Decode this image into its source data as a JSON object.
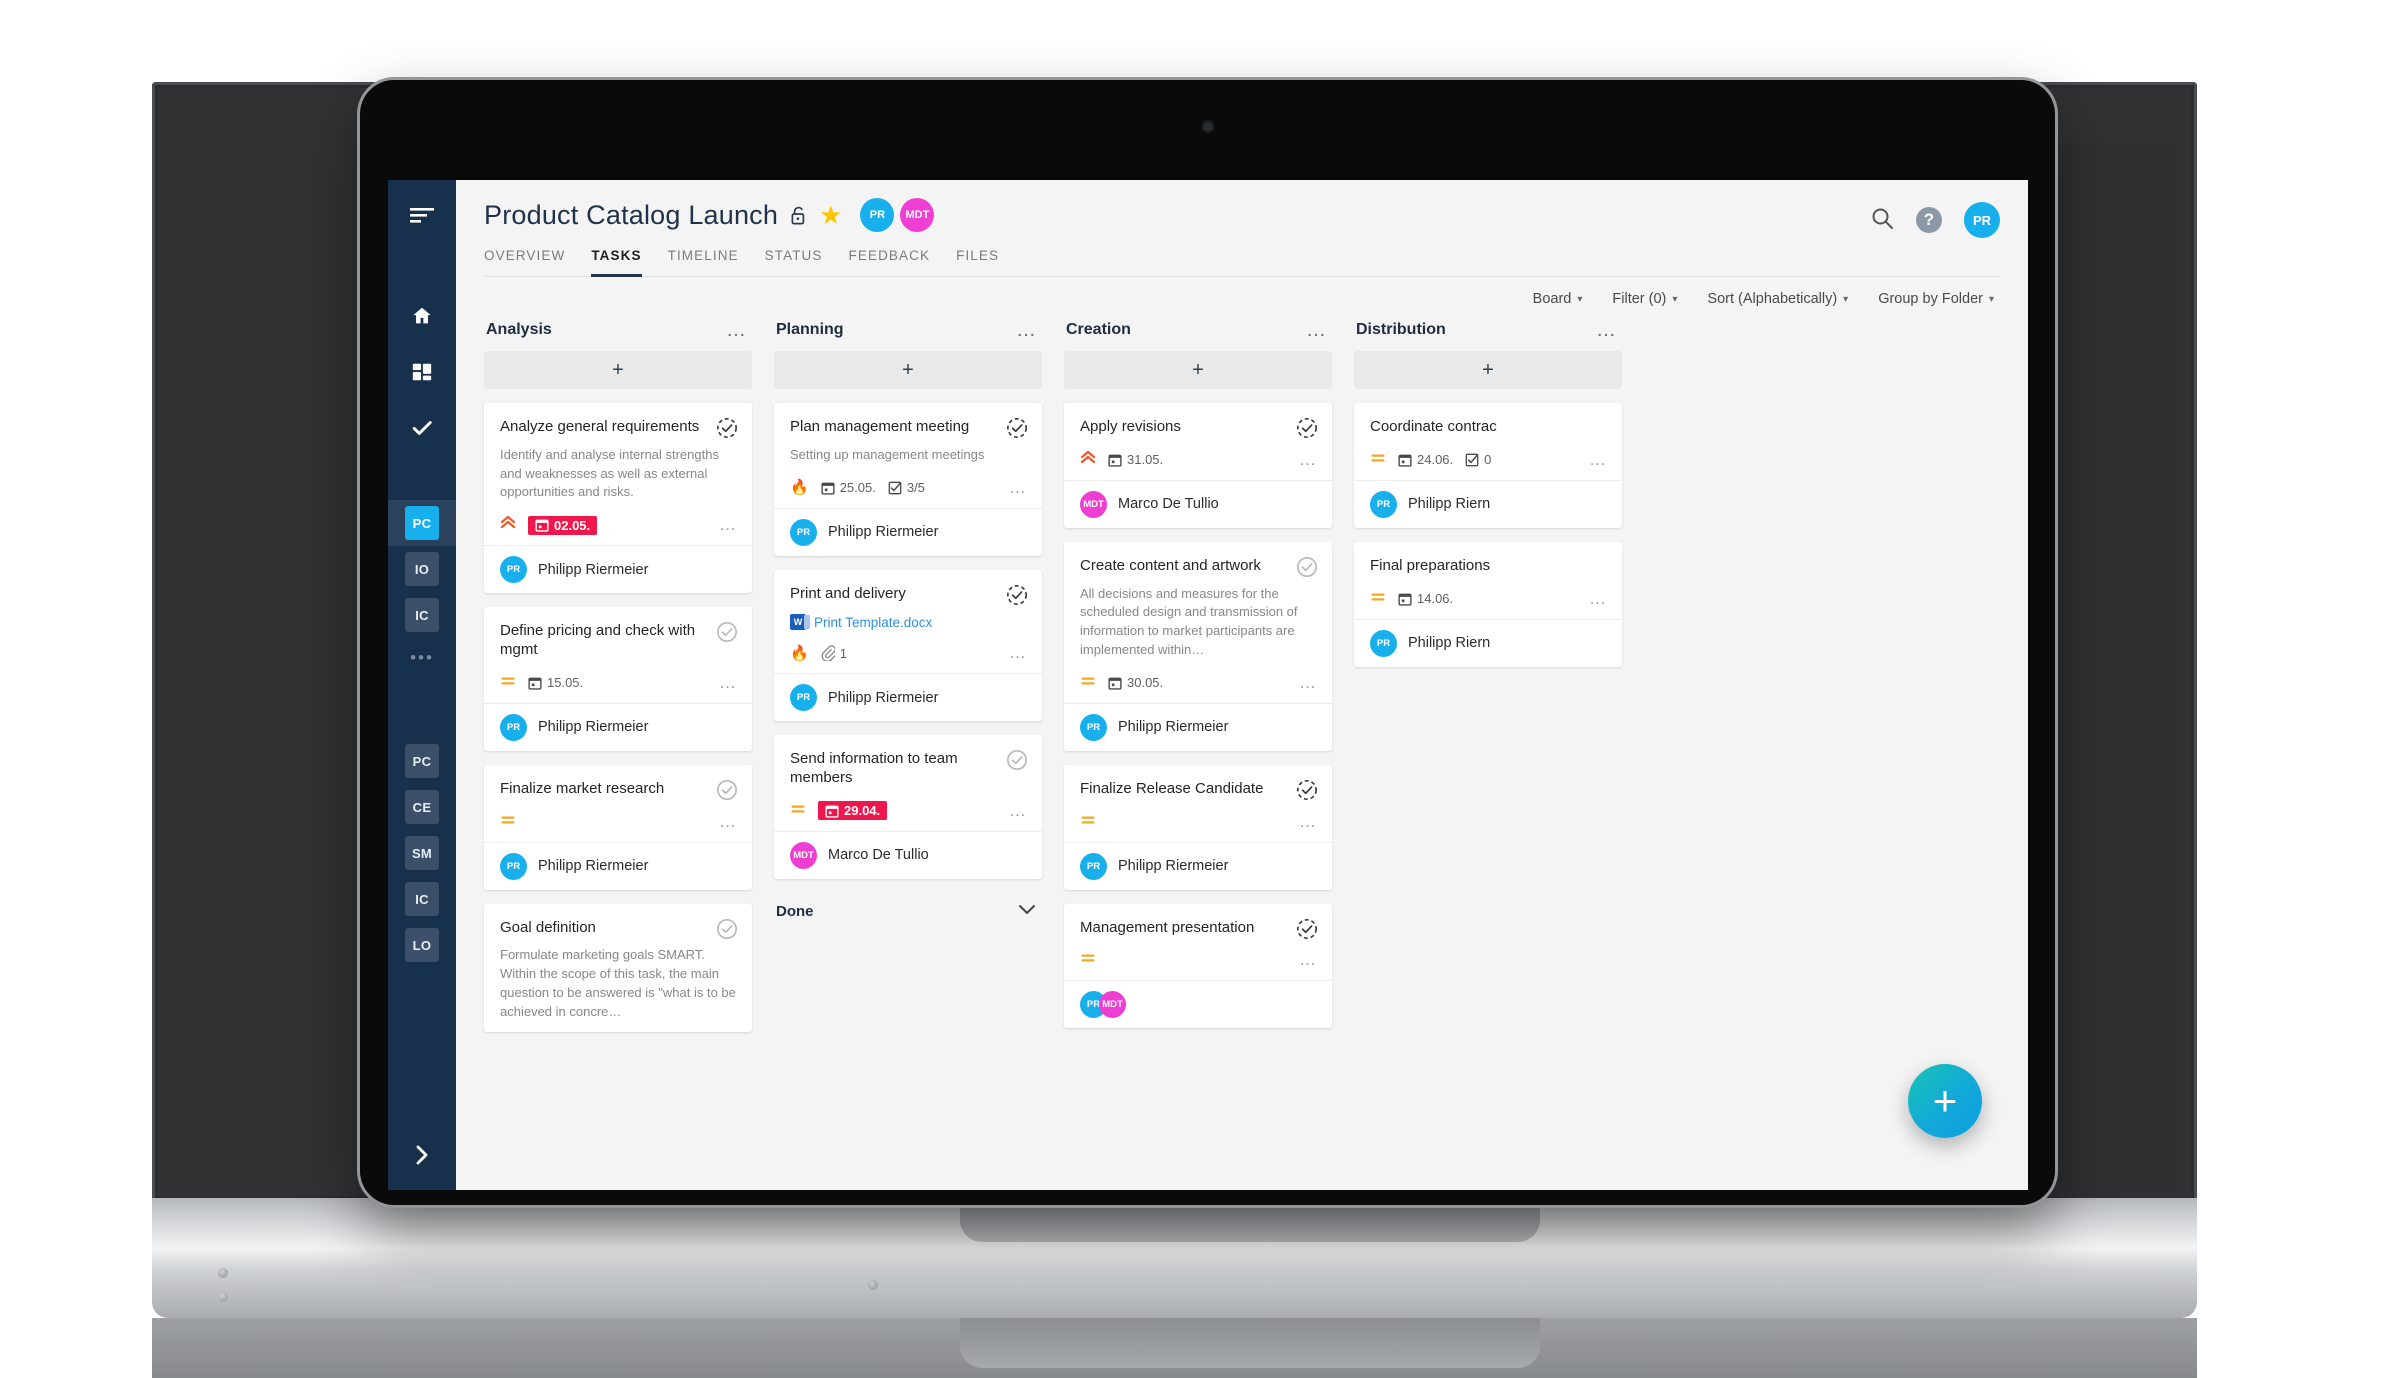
{
  "sidebar": {
    "menu_icon": "hamburger-menu-icon",
    "nav_icons": [
      "home-icon",
      "dashboard-grid-icon",
      "check-icon"
    ],
    "project_tiles_top": [
      {
        "label": "PC",
        "active": true
      },
      {
        "label": "IO",
        "active": false
      },
      {
        "label": "IC",
        "active": false
      }
    ],
    "overflow": "•••",
    "project_tiles_bottom": [
      {
        "label": "PC"
      },
      {
        "label": "CE"
      },
      {
        "label": "SM"
      },
      {
        "label": "IC"
      },
      {
        "label": "LO"
      }
    ],
    "expand_icon": "chevron-right-icon"
  },
  "header": {
    "title": "Product Catalog Launch",
    "lock_icon": "unlocked-padlock-icon",
    "star_icon": "star-filled-icon",
    "members": [
      {
        "initials": "PR",
        "color": "#18b0ec"
      },
      {
        "initials": "MDT",
        "color": "#ee3fd2"
      }
    ],
    "search_icon": "search-icon",
    "help_icon": "help-icon",
    "help_label": "?",
    "user_avatar": {
      "initials": "PR",
      "color": "#18b0ec"
    },
    "tabs": [
      {
        "label": "OVERVIEW",
        "active": false
      },
      {
        "label": "TASKS",
        "active": true
      },
      {
        "label": "TIMELINE",
        "active": false
      },
      {
        "label": "STATUS",
        "active": false
      },
      {
        "label": "FEEDBACK",
        "active": false
      },
      {
        "label": "FILES",
        "active": false
      }
    ]
  },
  "toolbar": {
    "view_label": "Board",
    "filter_label": "Filter (0)",
    "sort_label": "Sort (Alphabetically)",
    "group_label": "Group by Folder"
  },
  "board": {
    "add_label": "+",
    "done_label": "Done",
    "columns": [
      {
        "title": "Analysis",
        "cards": [
          {
            "title": "Analyze general requirements",
            "desc": "Identify and analyse internal strengths and weaknesses as well as external opportunities and risks.",
            "priority": "high",
            "date": "02.05.",
            "date_overdue": true,
            "status": "in-progress",
            "assignees": [
              {
                "initials": "PR",
                "color": "#18b0ec",
                "name": "Philipp Riermeier"
              }
            ]
          },
          {
            "title": "Define pricing and check with mgmt",
            "desc": "",
            "priority": "normal",
            "date": "15.05.",
            "date_overdue": false,
            "status": "open",
            "assignees": [
              {
                "initials": "PR",
                "color": "#18b0ec",
                "name": "Philipp Riermeier"
              }
            ]
          },
          {
            "title": "Finalize market research",
            "desc": "",
            "priority": "normal",
            "date": "",
            "date_overdue": false,
            "status": "open",
            "assignees": [
              {
                "initials": "PR",
                "color": "#18b0ec",
                "name": "Philipp Riermeier"
              }
            ]
          },
          {
            "title": "Goal definition",
            "desc": "Formulate marketing goals SMART. Within the scope of this task, the main question to be answered is \"what is to be achieved in concre…",
            "priority": "",
            "date": "",
            "date_overdue": false,
            "status": "open",
            "assignees": []
          }
        ]
      },
      {
        "title": "Planning",
        "cards": [
          {
            "title": "Plan management meeting",
            "desc": "Setting up management meetings",
            "priority": "urgent",
            "date": "25.05.",
            "date_overdue": false,
            "checklist": "3/5",
            "status": "in-progress",
            "assignees": [
              {
                "initials": "PR",
                "color": "#18b0ec",
                "name": "Philipp Riermeier"
              }
            ]
          },
          {
            "title": "Print and delivery",
            "desc": "",
            "attachment": "Print Template.docx",
            "priority": "urgent",
            "attachment_count": "1",
            "status": "in-progress",
            "assignees": [
              {
                "initials": "PR",
                "color": "#18b0ec",
                "name": "Philipp Riermeier"
              }
            ]
          },
          {
            "title": "Send information to team members",
            "desc": "",
            "priority": "normal",
            "date": "29.04.",
            "date_overdue": true,
            "status": "open",
            "assignees": [
              {
                "initials": "MDT",
                "color": "#ee3fd2",
                "name": "Marco De Tullio"
              }
            ]
          }
        ]
      },
      {
        "title": "Creation",
        "cards": [
          {
            "title": "Apply revisions",
            "desc": "",
            "priority": "high",
            "date": "31.05.",
            "date_overdue": false,
            "status": "in-progress",
            "assignees": [
              {
                "initials": "MDT",
                "color": "#ee3fd2",
                "name": "Marco De Tullio"
              }
            ]
          },
          {
            "title": "Create content and artwork",
            "desc": "All decisions and measures for the scheduled design and transmission of information to market participants are implemented within…",
            "priority": "normal",
            "date": "30.05.",
            "date_overdue": false,
            "status": "open",
            "assignees": [
              {
                "initials": "PR",
                "color": "#18b0ec",
                "name": "Philipp Riermeier"
              }
            ]
          },
          {
            "title": "Finalize Release Candidate",
            "desc": "",
            "priority": "normal",
            "date": "",
            "date_overdue": false,
            "status": "in-progress",
            "assignees": [
              {
                "initials": "PR",
                "color": "#18b0ec",
                "name": "Philipp Riermeier"
              }
            ]
          },
          {
            "title": "Management presentation",
            "desc": "",
            "priority": "normal",
            "date": "",
            "date_overdue": false,
            "status": "in-progress",
            "assignees": [
              {
                "initials": "PR",
                "color": "#18b0ec",
                "name": ""
              },
              {
                "initials": "MDT",
                "color": "#ee3fd2",
                "name": ""
              }
            ]
          }
        ]
      },
      {
        "title": "Distribution",
        "cards": [
          {
            "title": "Coordinate contrac",
            "desc": "",
            "priority": "normal",
            "date": "24.06.",
            "date_overdue": false,
            "checklist": "0",
            "status": "",
            "assignees": [
              {
                "initials": "PR",
                "color": "#18b0ec",
                "name": "Philipp Riern"
              }
            ]
          },
          {
            "title": "Final preparations",
            "desc": "",
            "priority": "normal",
            "date": "14.06.",
            "date_overdue": false,
            "status": "",
            "assignees": [
              {
                "initials": "PR",
                "color": "#18b0ec",
                "name": "Philipp Riern"
              }
            ]
          }
        ]
      }
    ]
  },
  "fab": {
    "icon": "plus-icon",
    "label": "+"
  }
}
